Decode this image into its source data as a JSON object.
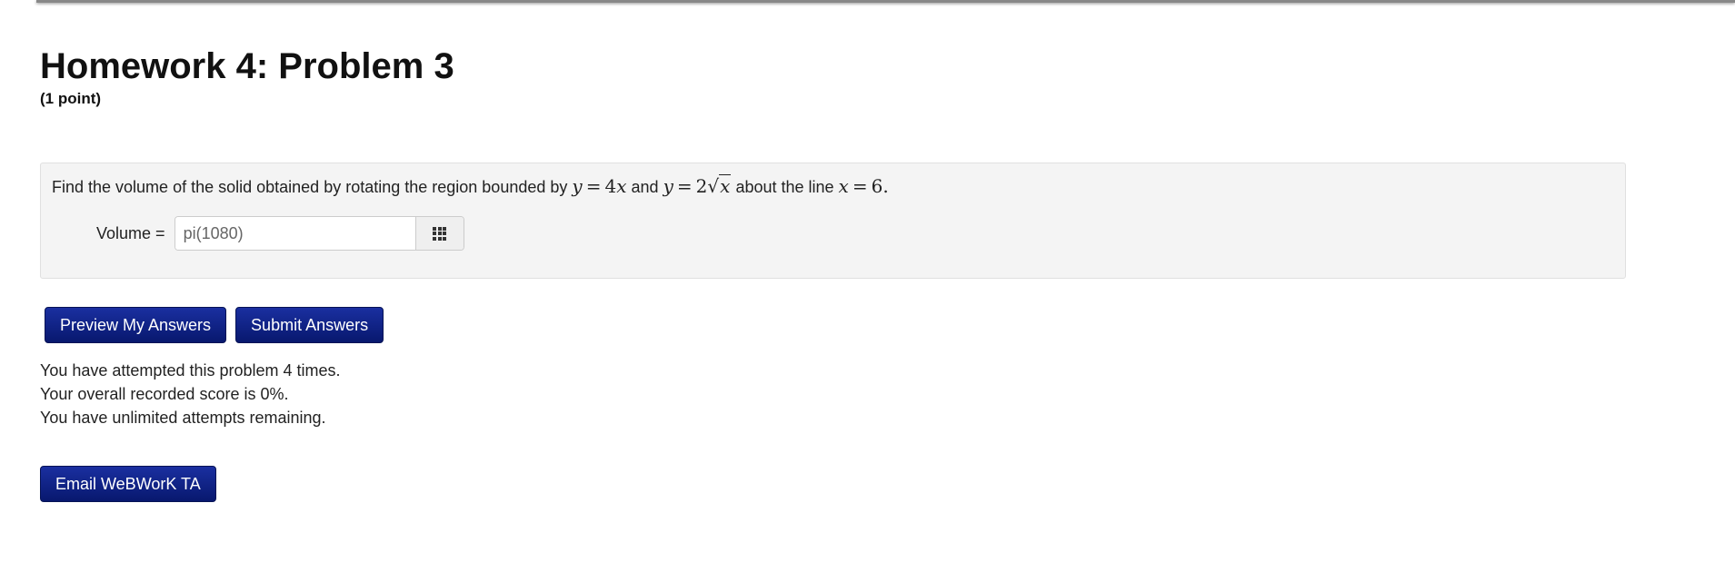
{
  "page": {
    "title": "Homework 4: Problem 3",
    "points": "(1 point)"
  },
  "problem": {
    "text_prefix": "Find the volume of the solid obtained by rotating the region bounded by",
    "text_and": "and",
    "text_about": "about the line",
    "eq1": {
      "lhs": "y",
      "op": "=",
      "coef": "4",
      "var": "x"
    },
    "eq2": {
      "lhs": "y",
      "op": "=",
      "coef": "2",
      "radical": "√",
      "radicand": "x"
    },
    "eq3": {
      "lhs": "x",
      "op": "=",
      "rhs": "6",
      "end": "."
    }
  },
  "answer": {
    "label": "Volume =",
    "placeholder": "pi(1080)",
    "value": "",
    "grid_icon": "grid-icon"
  },
  "buttons": {
    "preview": "Preview My Answers",
    "submit": "Submit Answers",
    "email": "Email WeBWorK TA"
  },
  "status": {
    "attempts": "You have attempted this problem 4 times.",
    "score": "Your overall recorded score is 0%.",
    "remaining": "You have unlimited attempts remaining."
  },
  "colors": {
    "button": "#0b1f8a",
    "problem_bg": "#f4f4f4"
  }
}
